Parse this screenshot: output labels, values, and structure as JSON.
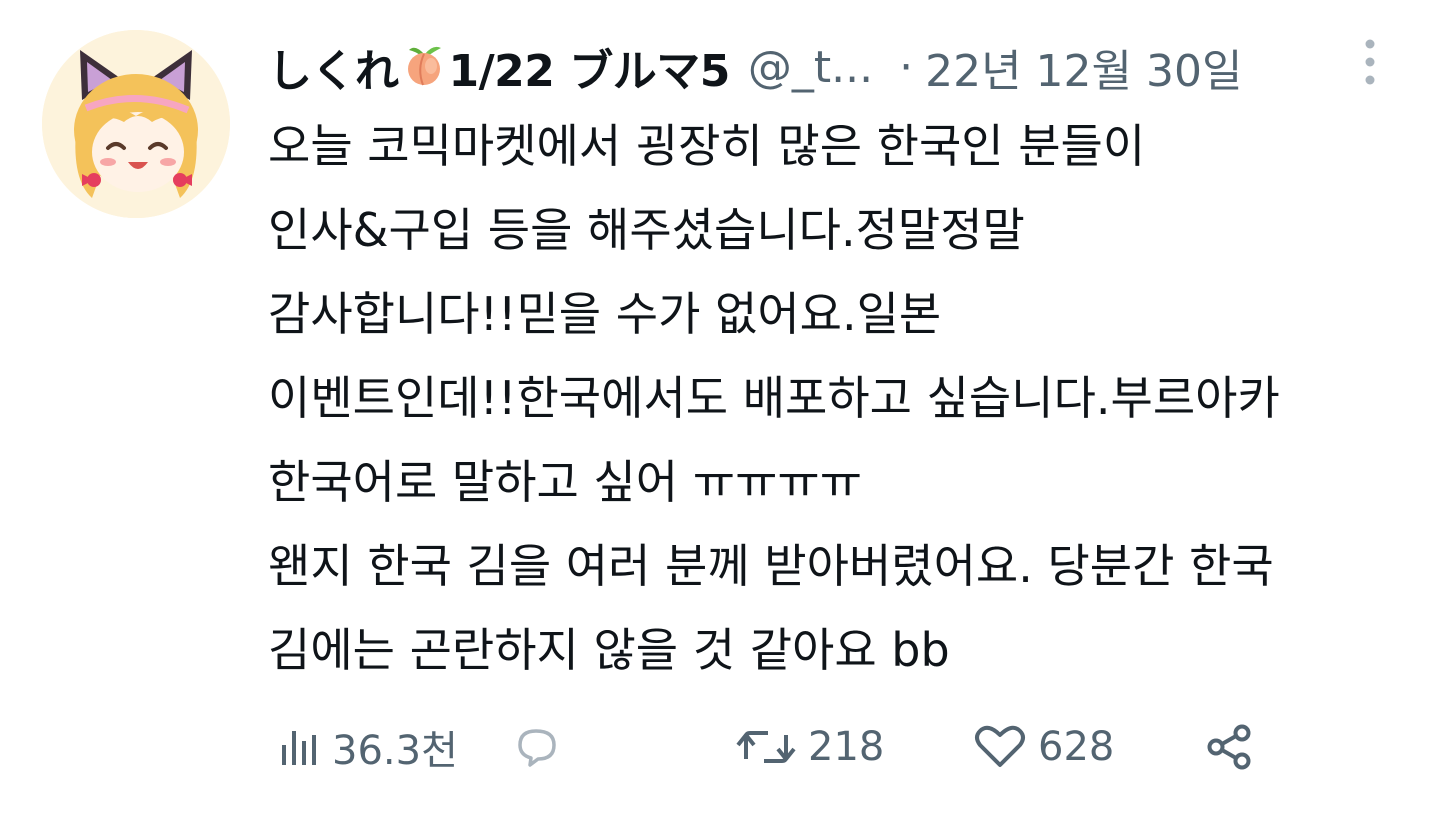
{
  "tweet": {
    "author": {
      "name_part1": "しくれ",
      "name_part2": "1/22 ブルマ5",
      "name_emoji": "peach-emoji",
      "handle": "@_t...",
      "avatar": "anime-catgirl-avatar"
    },
    "separator": "·",
    "date": "22년 12월 30일",
    "more_icon": "more-vertical-icon",
    "text_lines": [
      "오늘 코믹마켓에서 굉장히 많은 한국인 분들이",
      "인사&구입 등을 해주셨습니다.정말정말",
      "감사합니다!!믿을 수가 없어요.일본",
      "이벤트인데!!한국에서도 배포하고 싶습니다.부르아카",
      "한국어로 말하고 싶어 ㅠㅠㅠㅠ",
      "왠지 한국 김을 여러 분께 받아버렸어요. 당분간 한국",
      "김에는 곤란하지 않을 것 같아요 bb"
    ],
    "actions": {
      "views": {
        "icon": "analytics-icon",
        "count": "36.3천"
      },
      "reply": {
        "icon": "reply-icon",
        "count": ""
      },
      "retweet": {
        "icon": "retweet-icon",
        "count": "218"
      },
      "like": {
        "icon": "heart-icon",
        "count": "628"
      },
      "share": {
        "icon": "share-icon",
        "count": ""
      }
    }
  },
  "colors": {
    "primary_text": "#0f1419",
    "secondary_text": "#536471",
    "avatar_bg": "#fdf3dc",
    "peach": "#f4a07a"
  }
}
